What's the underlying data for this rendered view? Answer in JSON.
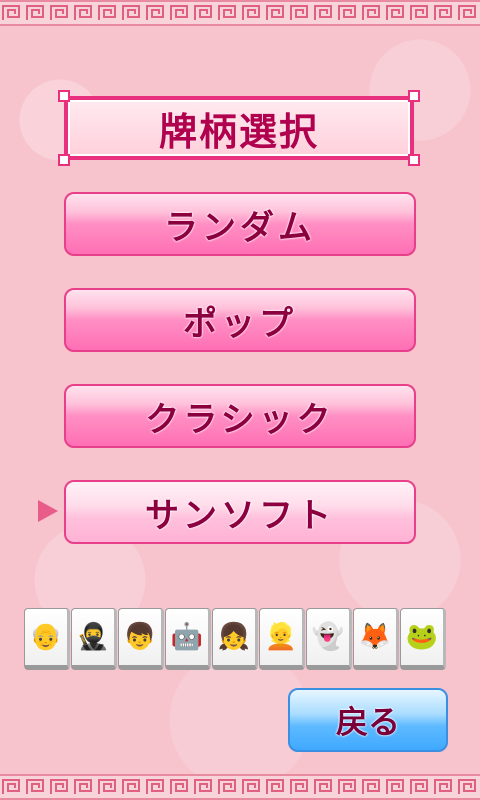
{
  "title": "牌柄選択",
  "menu": [
    {
      "label": "ランダム"
    },
    {
      "label": "ポップ"
    },
    {
      "label": "クラシック"
    },
    {
      "label": "サンソフト",
      "selected": true
    }
  ],
  "tiles": [
    {
      "name": "old-man",
      "glyph": "👴"
    },
    {
      "name": "ninja",
      "glyph": "🥷"
    },
    {
      "name": "hero-boy",
      "glyph": "👦"
    },
    {
      "name": "armored-boy",
      "glyph": "🤖"
    },
    {
      "name": "red-hair-girl",
      "glyph": "👧"
    },
    {
      "name": "blonde-girl",
      "glyph": "👱"
    },
    {
      "name": "ghost",
      "glyph": "👻"
    },
    {
      "name": "fox",
      "glyph": "🦊"
    },
    {
      "name": "frog",
      "glyph": "🐸"
    }
  ],
  "back_label": "戻る",
  "colors": {
    "background": "#f7c3cd",
    "menu_accent": "#e73f8a",
    "back_accent": "#3fa9ff",
    "text": "#8c0040"
  }
}
